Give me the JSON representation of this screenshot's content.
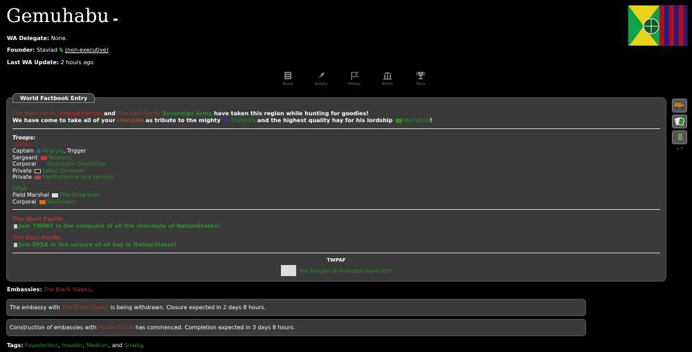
{
  "region": {
    "name": "Gemuhabu",
    "wa_delegate_label": "WA Delegate:",
    "wa_delegate_value": "None.",
    "founder_label": "Founder:",
    "founder_name": "Stavlad",
    "founder_status": "(non-executive)",
    "last_update_label": "Last WA Update:",
    "last_update_value": "2 hours ago"
  },
  "nav": [
    {
      "label": "Board",
      "icon": "board-icon"
    },
    {
      "label": "Activity",
      "icon": "activity-icon"
    },
    {
      "label": "History",
      "icon": "history-icon"
    },
    {
      "label": "Admin",
      "icon": "admin-icon"
    },
    {
      "label": "Rank",
      "icon": "rank-icon"
    }
  ],
  "factbook": {
    "tab_label": "World Factbook Entry",
    "line1": {
      "a": "The West Pacific",
      "b": "Armed Forces",
      "c": "and",
      "d": "The East Pacific",
      "e": "Sovereign Army",
      "f": "have taken this region while hunting for goodies!"
    },
    "line2": {
      "a": "We have come to take all of your",
      "b": "chocolate",
      "c": "as tribute to the mighty",
      "d": "Darkesia",
      "e": "and the highest quality hay for his lordship",
      "f": "Marrabuk",
      "g": "!"
    },
    "troops_heading": "Troops:",
    "twpaf_label": "TWPAF",
    "twpaf": [
      {
        "rank": "Captain",
        "name": "Nravyw",
        "extra": ", Trigger"
      },
      {
        "rank": "Sergeant",
        "name": "Teralyon",
        "extra": ""
      },
      {
        "rank": "Corporal",
        "name": "Aluminum Oxynitride",
        "extra": ""
      },
      {
        "rank": "Private",
        "name": "Lollar Corleone",
        "extra": ""
      },
      {
        "rank": "Private",
        "name": "Hertfordshire and Jamirdo",
        "extra": ""
      }
    ],
    "epsa_label": "EPSA",
    "epsa": [
      {
        "rank": "Field Marshal",
        "name": "The Atlae Isles"
      },
      {
        "rank": "Corporal",
        "name": "Wolfastein"
      }
    ],
    "twp_heading": "The West Pacific",
    "twp_join": "Join TWPAF in the conquest of all the chocolate of NationStates!",
    "tep_heading": "The East Pacific",
    "tep_join": "Join EPSA in the seizure of all hay in NationStates!",
    "footer_title": "TWPAF",
    "footer_link": "The Republic of Terracotta Gaurd 0077"
  },
  "rightbar": {
    "more": "+7"
  },
  "embassies": {
    "label": "Embassies:",
    "value": "The Black Hawks",
    "end": "."
  },
  "notices": [
    {
      "a": "The embassy with",
      "b": "The Black Hawks",
      "c": "is being withdrawn. Closure expected in 2 days 8 hours."
    },
    {
      "a": "Construction of embassies with",
      "b": "Frozen Circle",
      "c": "has commenced. Completion expected in 3 days 8 hours."
    }
  ],
  "tags": {
    "label": "Tags:",
    "items": [
      "Founderless",
      "Invader",
      "Medium",
      "Snarky"
    ],
    "sep1": ",",
    "sep2": ",",
    "sep3": ", and",
    "end": "."
  },
  "colors": {
    "background": "#000000",
    "panel": "#3a3a3a",
    "red_text": "#b22222",
    "green_text": "#2a8f2a"
  }
}
